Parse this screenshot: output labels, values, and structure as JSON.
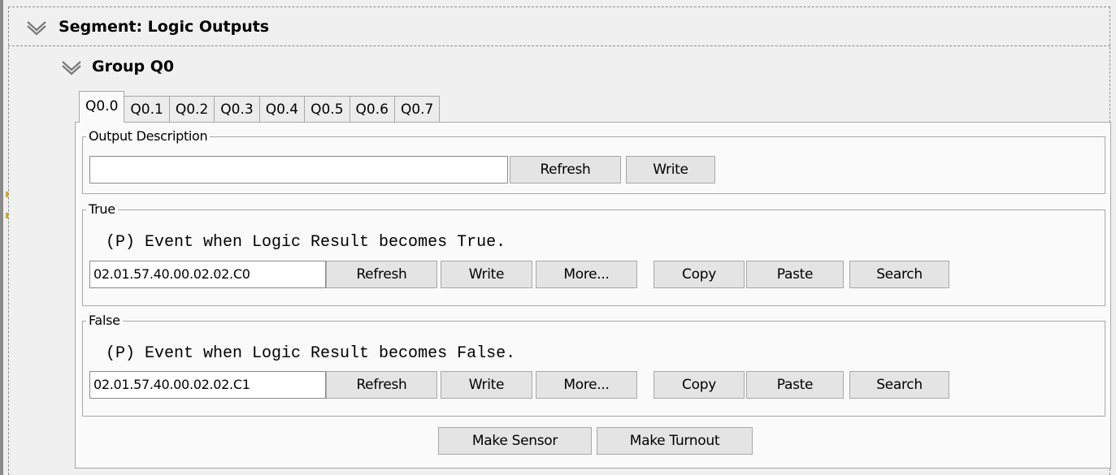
{
  "segment": {
    "title": "Segment: Logic Outputs",
    "icon": "double-chevron-down-icon"
  },
  "group": {
    "title": "Group Q0",
    "icon": "double-chevron-down-icon"
  },
  "tabs": [
    {
      "label": "Q0.0",
      "active": true
    },
    {
      "label": "Q0.1",
      "active": false
    },
    {
      "label": "Q0.2",
      "active": false
    },
    {
      "label": "Q0.3",
      "active": false
    },
    {
      "label": "Q0.4",
      "active": false
    },
    {
      "label": "Q0.5",
      "active": false
    },
    {
      "label": "Q0.6",
      "active": false
    },
    {
      "label": "Q0.7",
      "active": false
    }
  ],
  "output_description": {
    "legend": "Output Description",
    "value": "",
    "refresh_label": "Refresh",
    "write_label": "Write"
  },
  "true_event": {
    "legend": "True",
    "description": "(P) Event when Logic Result becomes True.",
    "value": "02.01.57.40.00.02.02.C0",
    "refresh_label": "Refresh",
    "write_label": "Write",
    "more_label": "More...",
    "copy_label": "Copy",
    "paste_label": "Paste",
    "search_label": "Search"
  },
  "false_event": {
    "legend": "False",
    "description": "(P) Event when Logic Result becomes False.",
    "value": "02.01.57.40.00.02.02.C1",
    "refresh_label": "Refresh",
    "write_label": "Write",
    "more_label": "More...",
    "copy_label": "Copy",
    "paste_label": "Paste",
    "search_label": "Search"
  },
  "actions": {
    "make_sensor_label": "Make Sensor",
    "make_turnout_label": "Make Turnout"
  }
}
